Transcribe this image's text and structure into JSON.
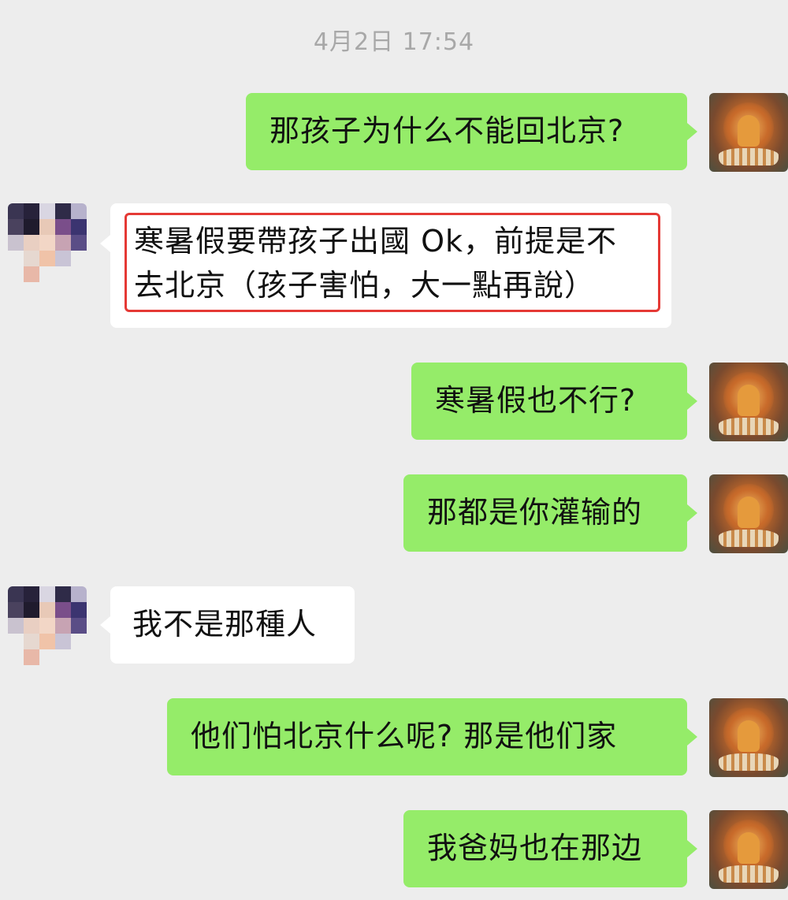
{
  "chat": {
    "timestamp": "4月2日 17:54",
    "messages": [
      {
        "sender": "me",
        "text": "那孩子为什么不能回北京?"
      },
      {
        "sender": "them",
        "lines": [
          "寒暑假要帶孩子出國 Ok，前提是不",
          "去北京（孩子害怕，大一點再說）"
        ],
        "highlighted": true
      },
      {
        "sender": "me",
        "text": "寒暑假也不行?"
      },
      {
        "sender": "me",
        "text": "那都是你灌输的"
      },
      {
        "sender": "them",
        "text": "我不是那種人"
      },
      {
        "sender": "me",
        "text": "他们怕北京什么呢? 那是他们家"
      },
      {
        "sender": "me",
        "text": "我爸妈也在那边"
      }
    ]
  },
  "colors": {
    "background": "#ededed",
    "my_bubble": "#95ec69",
    "their_bubble": "#ffffff",
    "highlight": "#e53935",
    "timestamp_text": "#a8a8a8"
  },
  "icons": {
    "my_avatar": "buddha-painting-avatar",
    "their_avatar": "pixelated-avatar"
  }
}
